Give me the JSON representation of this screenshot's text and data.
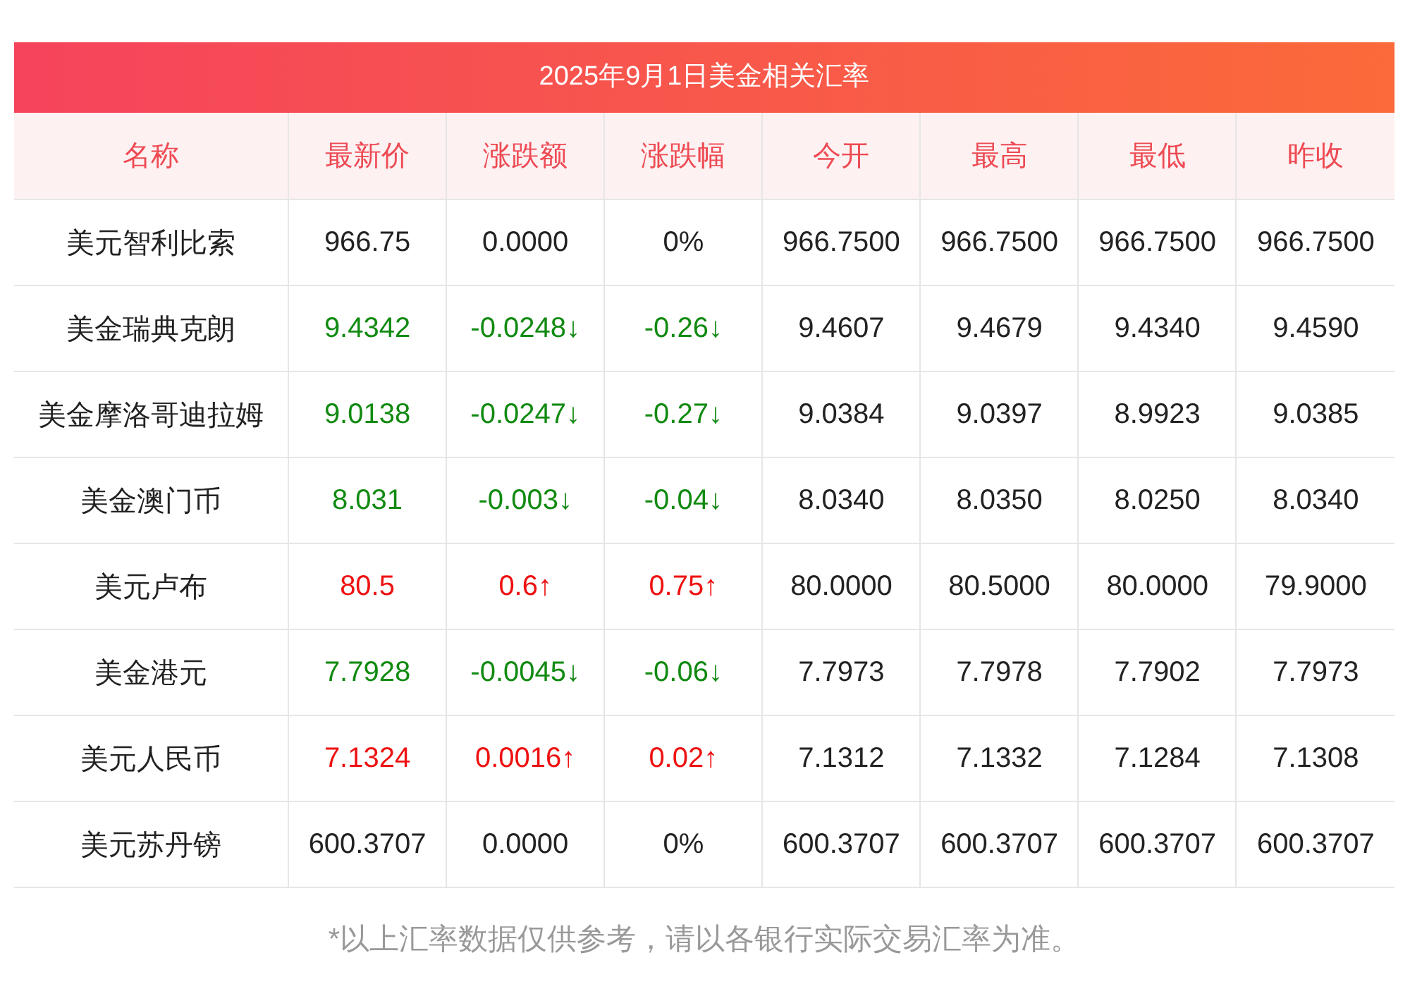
{
  "title": "2025年9月1日美金相关汇率",
  "columns": [
    "名称",
    "最新价",
    "涨跌额",
    "涨跌幅",
    "今开",
    "最高",
    "最低",
    "昨收"
  ],
  "rows": [
    {
      "name": "美元智利比索",
      "latest": "966.75",
      "change": "0.0000",
      "pct": "0%",
      "open": "966.7500",
      "high": "966.7500",
      "low": "966.7500",
      "prev": "966.7500",
      "color": "#222222"
    },
    {
      "name": "美金瑞典克朗",
      "latest": "9.4342",
      "change": "-0.0248↓",
      "pct": "-0.26↓",
      "open": "9.4607",
      "high": "9.4679",
      "low": "9.4340",
      "prev": "9.4590",
      "color": "#118a11"
    },
    {
      "name": "美金摩洛哥迪拉姆",
      "latest": "9.0138",
      "change": "-0.0247↓",
      "pct": "-0.27↓",
      "open": "9.0384",
      "high": "9.0397",
      "low": "8.9923",
      "prev": "9.0385",
      "color": "#118a11"
    },
    {
      "name": "美金澳门币",
      "latest": "8.031",
      "change": "-0.003↓",
      "pct": "-0.04↓",
      "open": "8.0340",
      "high": "8.0350",
      "low": "8.0250",
      "prev": "8.0340",
      "color": "#118a11"
    },
    {
      "name": "美元卢布",
      "latest": "80.5",
      "change": "0.6↑",
      "pct": "0.75↑",
      "open": "80.0000",
      "high": "80.5000",
      "low": "80.0000",
      "prev": "79.9000",
      "color": "#ee1111"
    },
    {
      "name": "美金港元",
      "latest": "7.7928",
      "change": "-0.0045↓",
      "pct": "-0.06↓",
      "open": "7.7973",
      "high": "7.7978",
      "low": "7.7902",
      "prev": "7.7973",
      "color": "#118a11"
    },
    {
      "name": "美元人民币",
      "latest": "7.1324",
      "change": "0.0016↑",
      "pct": "0.02↑",
      "open": "7.1312",
      "high": "7.1332",
      "low": "7.1284",
      "prev": "7.1308",
      "color": "#ee1111"
    },
    {
      "name": "美元苏丹镑",
      "latest": "600.3707",
      "change": "0.0000",
      "pct": "0%",
      "open": "600.3707",
      "high": "600.3707",
      "low": "600.3707",
      "prev": "600.3707",
      "color": "#222222"
    }
  ],
  "footnote": "*以上汇率数据仅供参考，请以各银行实际交易汇率为准。"
}
